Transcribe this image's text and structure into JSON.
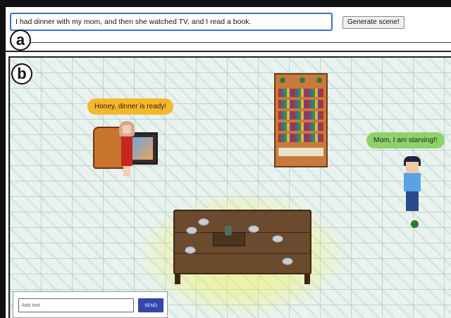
{
  "panel_a": {
    "label": "a",
    "prompt_value": "I had dinner with my mom, and then she watched TV, and I read a book.",
    "generate_label": "Generate scene!"
  },
  "panel_b": {
    "label": "b",
    "mom_speech": "Honey, dinner is ready!",
    "son_speech": "Mom, I am starving!!",
    "chat": {
      "placeholder": "Add text",
      "send_label": "SEND"
    }
  },
  "colors": {
    "input_border": "#3a6fd8",
    "mom_bubble": "#f5b82a",
    "son_bubble": "#8fd26a",
    "send_button": "#3346b0",
    "status_dot": "#2a7a2f"
  }
}
